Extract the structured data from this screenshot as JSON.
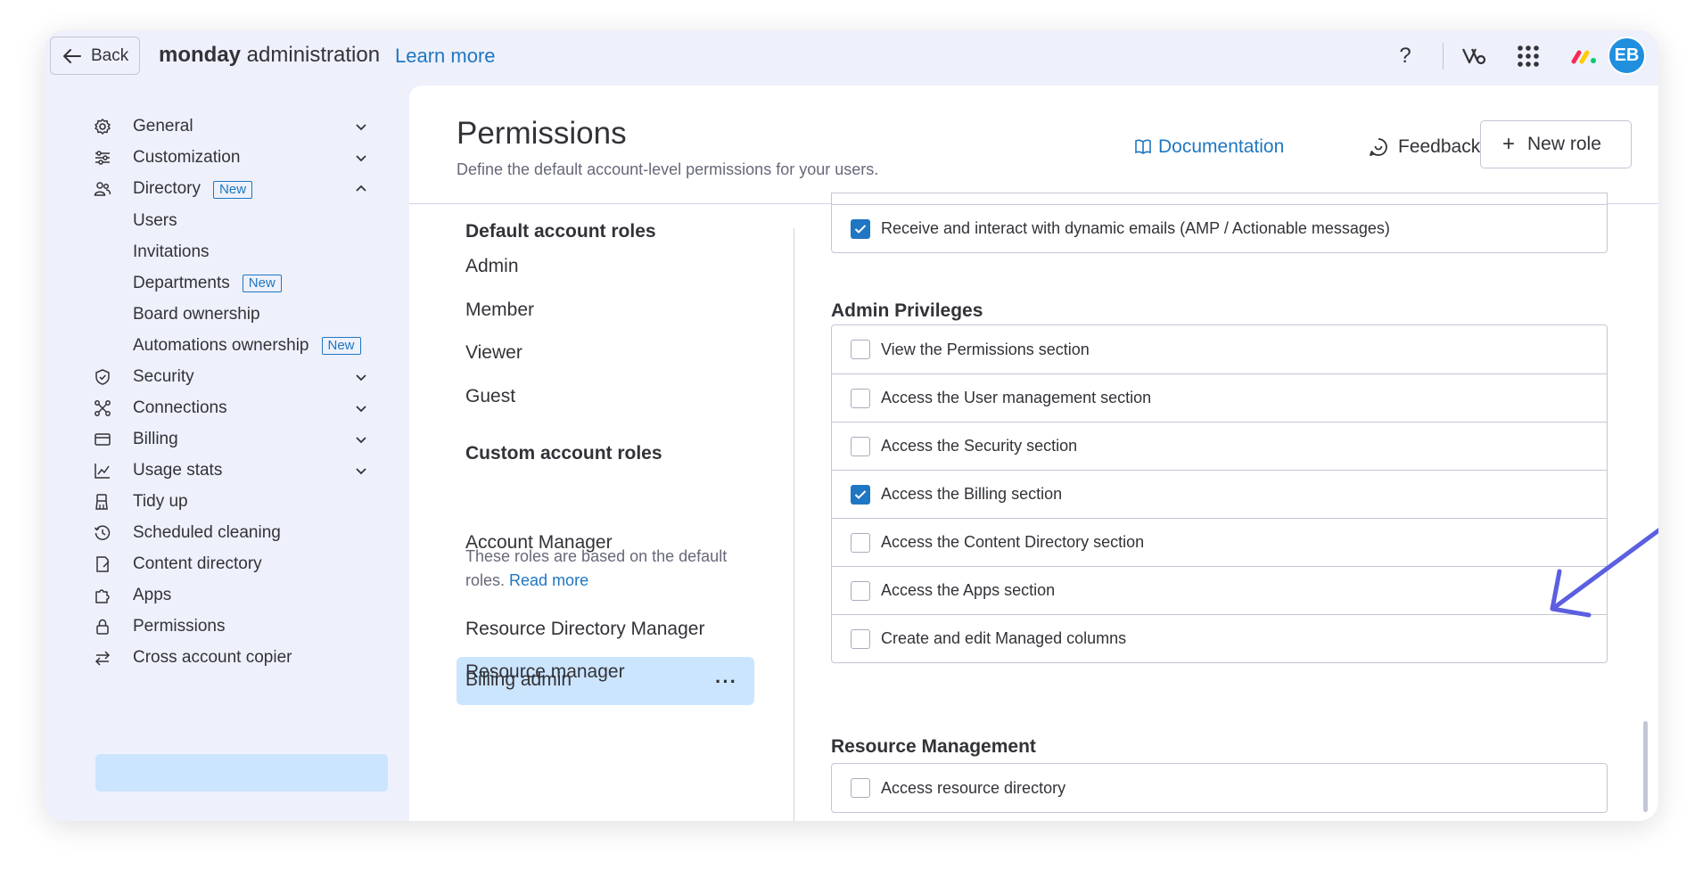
{
  "header": {
    "back_label": "Back",
    "brand_bold": "monday",
    "brand_rest": " administration",
    "learn_more": "Learn more",
    "help_glyph": "?",
    "avatar_initials": "EB",
    "icons": [
      "arrow-left-icon",
      "help-icon",
      "workflow-icon",
      "apps-grid-icon",
      "monday-logo-icon"
    ]
  },
  "sidebar": {
    "items": [
      {
        "label": "General",
        "icon": "gear-icon"
      },
      {
        "label": "Customization",
        "icon": "sliders-icon"
      },
      {
        "label": "Directory",
        "icon": "people-icon",
        "badge": "New"
      },
      {
        "label": "Security",
        "icon": "shield-icon"
      },
      {
        "label": "Connections",
        "icon": "connections-icon"
      },
      {
        "label": "Billing",
        "icon": "card-icon"
      },
      {
        "label": "Usage stats",
        "icon": "chart-icon"
      },
      {
        "label": "Tidy up",
        "icon": "broom-icon"
      },
      {
        "label": "Scheduled cleaning",
        "icon": "clock-icon"
      },
      {
        "label": "Content directory",
        "icon": "content-icon"
      },
      {
        "label": "Apps",
        "icon": "puzzle-icon"
      },
      {
        "label": "Permissions",
        "icon": "lock-icon"
      },
      {
        "label": "Cross account copier",
        "icon": "swap-icon"
      }
    ],
    "directory_sub": [
      {
        "label": "Users"
      },
      {
        "label": "Invitations"
      },
      {
        "label": "Departments",
        "badge": "New"
      },
      {
        "label": "Board ownership"
      },
      {
        "label": "Automations ownership",
        "badge": "New"
      }
    ]
  },
  "page": {
    "title": "Permissions",
    "subtitle": "Define the default account-level permissions for your users.",
    "documentation": "Documentation",
    "feedback": "Feedback",
    "new_role": "New role"
  },
  "roles": {
    "default_heading": "Default account roles",
    "default": [
      "Admin",
      "Member",
      "Viewer",
      "Guest"
    ],
    "custom_heading": "Custom account roles",
    "custom_desc": "These roles are based on the default roles.",
    "read_more": "Read more",
    "custom": [
      "Account Manager",
      "Billing admin",
      "Resource Directory Manager",
      "Resource manager"
    ],
    "selected": "Billing admin",
    "more_glyph": "···"
  },
  "permissions": {
    "top_row": {
      "label": "Receive and interact with dynamic emails (AMP / Actionable messages)",
      "checked": true
    },
    "admin_heading": "Admin Privileges",
    "admin": [
      {
        "label": "View the Permissions section",
        "checked": false
      },
      {
        "label": "Access the User management section",
        "checked": false
      },
      {
        "label": "Access the Security section",
        "checked": false
      },
      {
        "label": "Access the Billing section",
        "checked": true
      },
      {
        "label": "Access the Content Directory section",
        "checked": false
      },
      {
        "label": "Access the Apps section",
        "checked": false
      },
      {
        "label": "Create and edit Managed columns",
        "checked": false
      }
    ],
    "resource_heading": "Resource Management",
    "resource": [
      {
        "label": "Access resource directory",
        "checked": false
      }
    ]
  },
  "colors": {
    "accent": "#1f76c2",
    "selected_bg": "#cce5ff",
    "annotation_arrow": "#5b5fe0",
    "avatar": "#1f8fde"
  }
}
